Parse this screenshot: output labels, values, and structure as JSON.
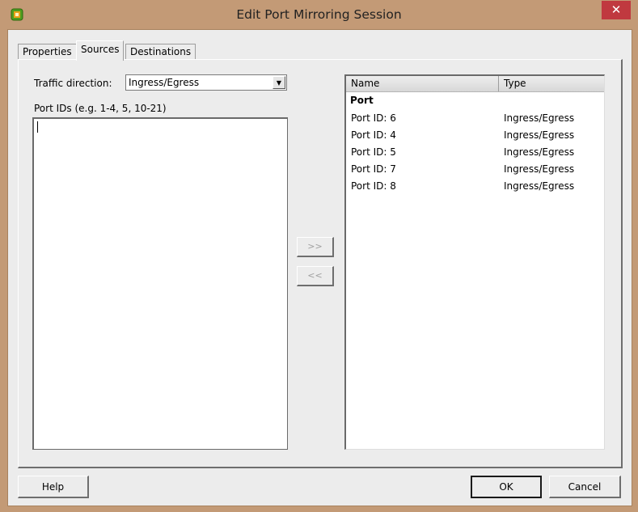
{
  "window": {
    "title": "Edit Port Mirroring Session",
    "close_glyph": "✕"
  },
  "tabs": [
    {
      "label": "Properties",
      "active": false
    },
    {
      "label": "Sources",
      "active": true
    },
    {
      "label": "Destinations",
      "active": false
    }
  ],
  "sources": {
    "traffic_direction_label": "Traffic direction:",
    "traffic_direction_value": "Ingress/Egress",
    "port_ids_label": "Port IDs (e.g. 1-4, 5, 10-21)",
    "port_ids_value": "",
    "add_button": ">>",
    "remove_button": "<<"
  },
  "list": {
    "columns": [
      "Name",
      "Type"
    ],
    "group_label": "Port",
    "rows": [
      {
        "name": "Port ID: 6",
        "type": "Ingress/Egress"
      },
      {
        "name": "Port ID: 4",
        "type": "Ingress/Egress"
      },
      {
        "name": "Port ID: 5",
        "type": "Ingress/Egress"
      },
      {
        "name": "Port ID: 7",
        "type": "Ingress/Egress"
      },
      {
        "name": "Port ID: 8",
        "type": "Ingress/Egress"
      }
    ]
  },
  "buttons": {
    "help": "Help",
    "ok": "OK",
    "cancel": "Cancel"
  }
}
